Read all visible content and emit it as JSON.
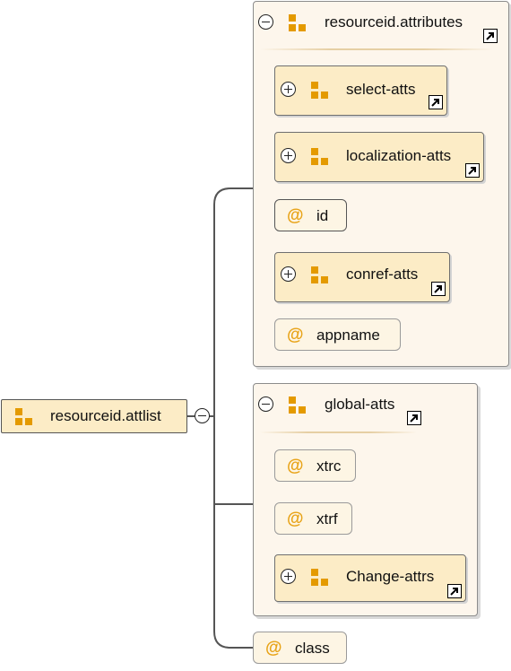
{
  "root": {
    "label": "resourceid.attlist",
    "icon": "attribute-group-icon",
    "toggle": "collapse"
  },
  "groups": [
    {
      "label": "resourceid.attributes",
      "icon": "attribute-group-icon",
      "reference_icon": "reference-arrow-icon",
      "children": [
        {
          "kind": "attribute-group",
          "label": "select-atts"
        },
        {
          "kind": "attribute-group",
          "label": "localization-atts"
        },
        {
          "kind": "attribute",
          "label": "id"
        },
        {
          "kind": "attribute-group",
          "label": "conref-atts"
        },
        {
          "kind": "attribute",
          "label": "appname"
        }
      ]
    },
    {
      "label": "global-atts",
      "icon": "attribute-group-icon",
      "reference_icon": "reference-arrow-icon",
      "children": [
        {
          "kind": "attribute",
          "label": "xtrc"
        },
        {
          "kind": "attribute",
          "label": "xtrf"
        },
        {
          "kind": "attribute-group",
          "label": "Change-attrs"
        }
      ]
    }
  ],
  "trailing_attribute": {
    "label": "class"
  },
  "attribute_symbol": "@",
  "colors": {
    "group_fill": "#fdf6ec",
    "node_fill": "#fcecc6",
    "attribute_fill": "#fdf5e4",
    "icon_orange": "#e49a00",
    "at_symbol": "#e8a317",
    "connector": "#555555"
  }
}
